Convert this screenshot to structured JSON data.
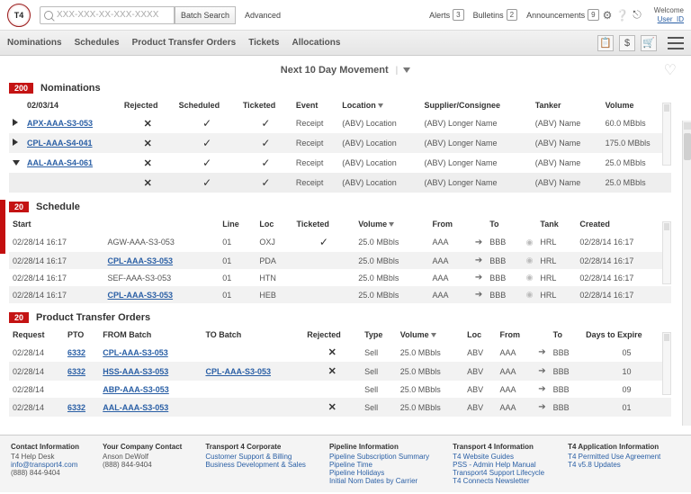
{
  "brand": "T4",
  "search": {
    "placeholder": "XXX-XXX-XX-XXX-XXXX",
    "batch_btn": "Batch Search",
    "advanced": "Advanced"
  },
  "alerts": {
    "alerts_label": "Alerts",
    "alerts_count": "3",
    "bulletins_label": "Bulletins",
    "bulletins_count": "2",
    "announcements_label": "Announcements",
    "announcements_count": "9"
  },
  "welcome": {
    "line1": "Welcome",
    "user": "User_ID"
  },
  "nav": {
    "nominations": "Nominations",
    "schedules": "Schedules",
    "pto": "Product Transfer Orders",
    "tickets": "Tickets",
    "allocations": "Allocations"
  },
  "movement_title": "Next 10 Day Movement",
  "nominations": {
    "count": "200",
    "title": "Nominations",
    "date": "02/03/14",
    "headers": {
      "rejected": "Rejected",
      "scheduled": "Scheduled",
      "ticketed": "Ticketed",
      "event": "Event",
      "location": "Location",
      "supcon": "Supplier/Consignee",
      "tanker": "Tanker",
      "volume": "Volume"
    },
    "rows": [
      {
        "expand": "right",
        "batch": "APX-AAA-S3-053",
        "rejected": true,
        "scheduled": true,
        "ticketed": true,
        "event": "Receipt",
        "location": "(ABV) Location",
        "supcon": "(ABV) Longer Name",
        "tanker": "(ABV) Name",
        "volume": "60.0 MBbls",
        "alt": false
      },
      {
        "expand": "right",
        "batch": "CPL-AAA-S4-041",
        "rejected": true,
        "scheduled": true,
        "ticketed": true,
        "event": "Receipt",
        "location": "(ABV) Location",
        "supcon": "(ABV) Longer Name",
        "tanker": "(ABV) Name",
        "volume": "175.0 MBbls",
        "alt": true
      },
      {
        "expand": "down",
        "batch": "AAL-AAA-S4-061",
        "rejected": true,
        "scheduled": true,
        "ticketed": true,
        "event": "Receipt",
        "location": "(ABV) Location",
        "supcon": "(ABV) Longer Name",
        "tanker": "(ABV) Name",
        "volume": "25.0 MBbls",
        "alt": false
      },
      {
        "expand": "",
        "batch": "",
        "rejected": true,
        "scheduled": true,
        "ticketed": true,
        "event": "Receipt",
        "location": "(ABV) Location",
        "supcon": "(ABV) Longer Name",
        "tanker": "(ABV) Name",
        "volume": "25.0 MBbls",
        "alt": true,
        "sub": true
      }
    ]
  },
  "schedule": {
    "count": "20",
    "title": "Schedule",
    "headers": {
      "start": "Start",
      "line": "Line",
      "loc": "Loc",
      "ticketed": "Ticketed",
      "volume": "Volume",
      "from": "From",
      "to": "To",
      "tank": "Tank",
      "created": "Created"
    },
    "rows": [
      {
        "start": "02/28/14  16:17",
        "batch": "AGW-AAA-S3-053",
        "link": false,
        "line": "01",
        "loc": "OXJ",
        "tick": true,
        "volume": "25.0 MBbls",
        "from": "AAA",
        "to": "BBB",
        "tank": "HRL",
        "created": "02/28/14  16:17",
        "alt": false
      },
      {
        "start": "02/28/14  16:17",
        "batch": "CPL-AAA-S3-053",
        "link": true,
        "line": "01",
        "loc": "PDA",
        "tick": false,
        "volume": "25.0 MBbls",
        "from": "AAA",
        "to": "BBB",
        "tank": "HRL",
        "created": "02/28/14  16:17",
        "alt": true
      },
      {
        "start": "02/28/14  16:17",
        "batch": "SEF-AAA-S3-053",
        "link": false,
        "line": "01",
        "loc": "HTN",
        "tick": false,
        "volume": "25.0 MBbls",
        "from": "AAA",
        "to": "BBB",
        "tank": "HRL",
        "created": "02/28/14  16:17",
        "alt": false
      },
      {
        "start": "02/28/14  16:17",
        "batch": "CPL-AAA-S3-053",
        "link": true,
        "line": "01",
        "loc": "HEB",
        "tick": false,
        "volume": "25.0 MBbls",
        "from": "AAA",
        "to": "BBB",
        "tank": "HRL",
        "created": "02/28/14  16:17",
        "alt": true
      }
    ]
  },
  "pto": {
    "count": "20",
    "title": "Product Transfer Orders",
    "headers": {
      "request": "Request",
      "pto": "PTO",
      "from_batch": "FROM Batch",
      "to_batch": "TO Batch",
      "rejected": "Rejected",
      "type": "Type",
      "volume": "Volume",
      "loc": "Loc",
      "from": "From",
      "to": "To",
      "days": "Days to Expire"
    },
    "rows": [
      {
        "request": "02/28/14",
        "pto": "6332",
        "from_batch": "CPL-AAA-S3-053",
        "to_batch": "",
        "rejected": true,
        "type": "Sell",
        "volume": "25.0 MBbls",
        "loc": "ABV",
        "from": "AAA",
        "to": "BBB",
        "days": "05",
        "alt": false
      },
      {
        "request": "02/28/14",
        "pto": "6332",
        "from_batch": "HSS-AAA-S3-053",
        "to_batch": "CPL-AAA-S3-053",
        "rejected": true,
        "type": "Sell",
        "volume": "25.0 MBbls",
        "loc": "ABV",
        "from": "AAA",
        "to": "BBB",
        "days": "10",
        "alt": true
      },
      {
        "request": "02/28/14",
        "pto": "",
        "from_batch": "ABP-AAA-S3-053",
        "to_batch": "",
        "rejected": false,
        "type": "Sell",
        "volume": "25.0 MBbls",
        "loc": "ABV",
        "from": "AAA",
        "to": "BBB",
        "days": "09",
        "alt": false
      },
      {
        "request": "02/28/14",
        "pto": "6332",
        "from_batch": "AAL-AAA-S3-053",
        "to_batch": "",
        "rejected": true,
        "type": "Sell",
        "volume": "25.0 MBbls",
        "loc": "ABV",
        "from": "AAA",
        "to": "BBB",
        "days": "01",
        "alt": true
      }
    ]
  },
  "footer": {
    "c1": {
      "h": "Contact Information",
      "l1": "T4 Help Desk",
      "l2": "info@transport4.com",
      "l3": "(888) 844-9404"
    },
    "c2": {
      "h": "Your Company Contact",
      "l1": "Anson DeWolf",
      "l2": "(888) 844-9404"
    },
    "c3": {
      "h": "Transport 4 Corporate",
      "l1": "Customer Support & Billing",
      "l2": "Business Development & Sales"
    },
    "c4": {
      "h": "Pipeline Information",
      "l1": "Pipeline Subscription Summary",
      "l2": "Pipeline Time",
      "l3": "Pipeline Holidays",
      "l4": "Initial Nom Dates by Carrier"
    },
    "c5": {
      "h": "Transport 4 Information",
      "l1": "T4 Website Guides",
      "l2": "PSS - Admin Help Manual",
      "l3": "Transport4 Support Lifecycle",
      "l4": "T4 Connects Newsletter"
    },
    "c6": {
      "h": "T4 Application Information",
      "l1": "T4 Permitted Use Agreement",
      "l2": "T4 v5.8 Updates"
    }
  }
}
